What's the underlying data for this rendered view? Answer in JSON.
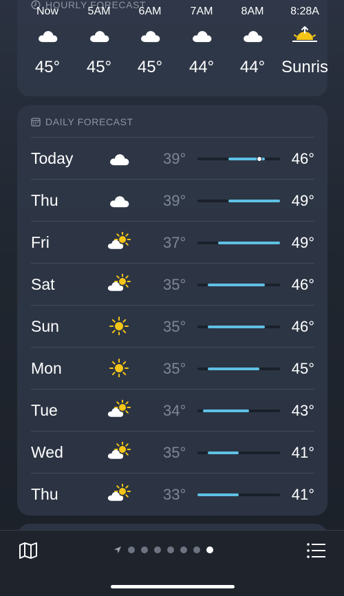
{
  "hourly": {
    "header": "HOURLY FORECAST",
    "hours": [
      {
        "time": "Now",
        "icon": "cloud-icon",
        "temp": "45°"
      },
      {
        "time": "5AM",
        "icon": "cloud-icon",
        "temp": "45°"
      },
      {
        "time": "6AM",
        "icon": "cloud-icon",
        "temp": "45°"
      },
      {
        "time": "7AM",
        "icon": "cloud-icon",
        "temp": "44°"
      },
      {
        "time": "8AM",
        "icon": "cloud-icon",
        "temp": "44°"
      },
      {
        "time": "8:28A",
        "icon": "sunrise-icon",
        "temp": "Sunris"
      }
    ]
  },
  "daily": {
    "header": "DAILY FORECAST",
    "scale": {
      "min": 33,
      "max": 49
    },
    "days": [
      {
        "day": "Today",
        "icon": "cloud-icon",
        "low": "39°",
        "high": "46°",
        "low_value": 39,
        "high_value": 46,
        "current_value": 45
      },
      {
        "day": "Thu",
        "icon": "cloud-icon",
        "low": "39°",
        "high": "49°",
        "low_value": 39,
        "high_value": 49
      },
      {
        "day": "Fri",
        "icon": "partly-sunny-icon",
        "low": "37°",
        "high": "49°",
        "low_value": 37,
        "high_value": 49
      },
      {
        "day": "Sat",
        "icon": "partly-sunny-icon",
        "low": "35°",
        "high": "46°",
        "low_value": 35,
        "high_value": 46
      },
      {
        "day": "Sun",
        "icon": "sun-icon",
        "low": "35°",
        "high": "46°",
        "low_value": 35,
        "high_value": 46
      },
      {
        "day": "Mon",
        "icon": "sun-icon",
        "low": "35°",
        "high": "45°",
        "low_value": 35,
        "high_value": 45
      },
      {
        "day": "Tue",
        "icon": "partly-sunny-icon",
        "low": "34°",
        "high": "43°",
        "low_value": 34,
        "high_value": 43
      },
      {
        "day": "Wed",
        "icon": "partly-sunny-icon",
        "low": "35°",
        "high": "41°",
        "low_value": 35,
        "high_value": 41
      },
      {
        "day": "Thu",
        "icon": "partly-sunny-icon",
        "low": "33°",
        "high": "41°",
        "low_value": 33,
        "high_value": 41
      }
    ]
  },
  "toolbar": {
    "map_icon": "map-icon",
    "location_icon": "location-arrow-icon",
    "list_icon": "list-icon",
    "page_count": 7,
    "active_page": 7
  },
  "colors": {
    "range_bar": "#5ec1e4",
    "sun": "#f5c518",
    "cloud": "#ffffff"
  }
}
